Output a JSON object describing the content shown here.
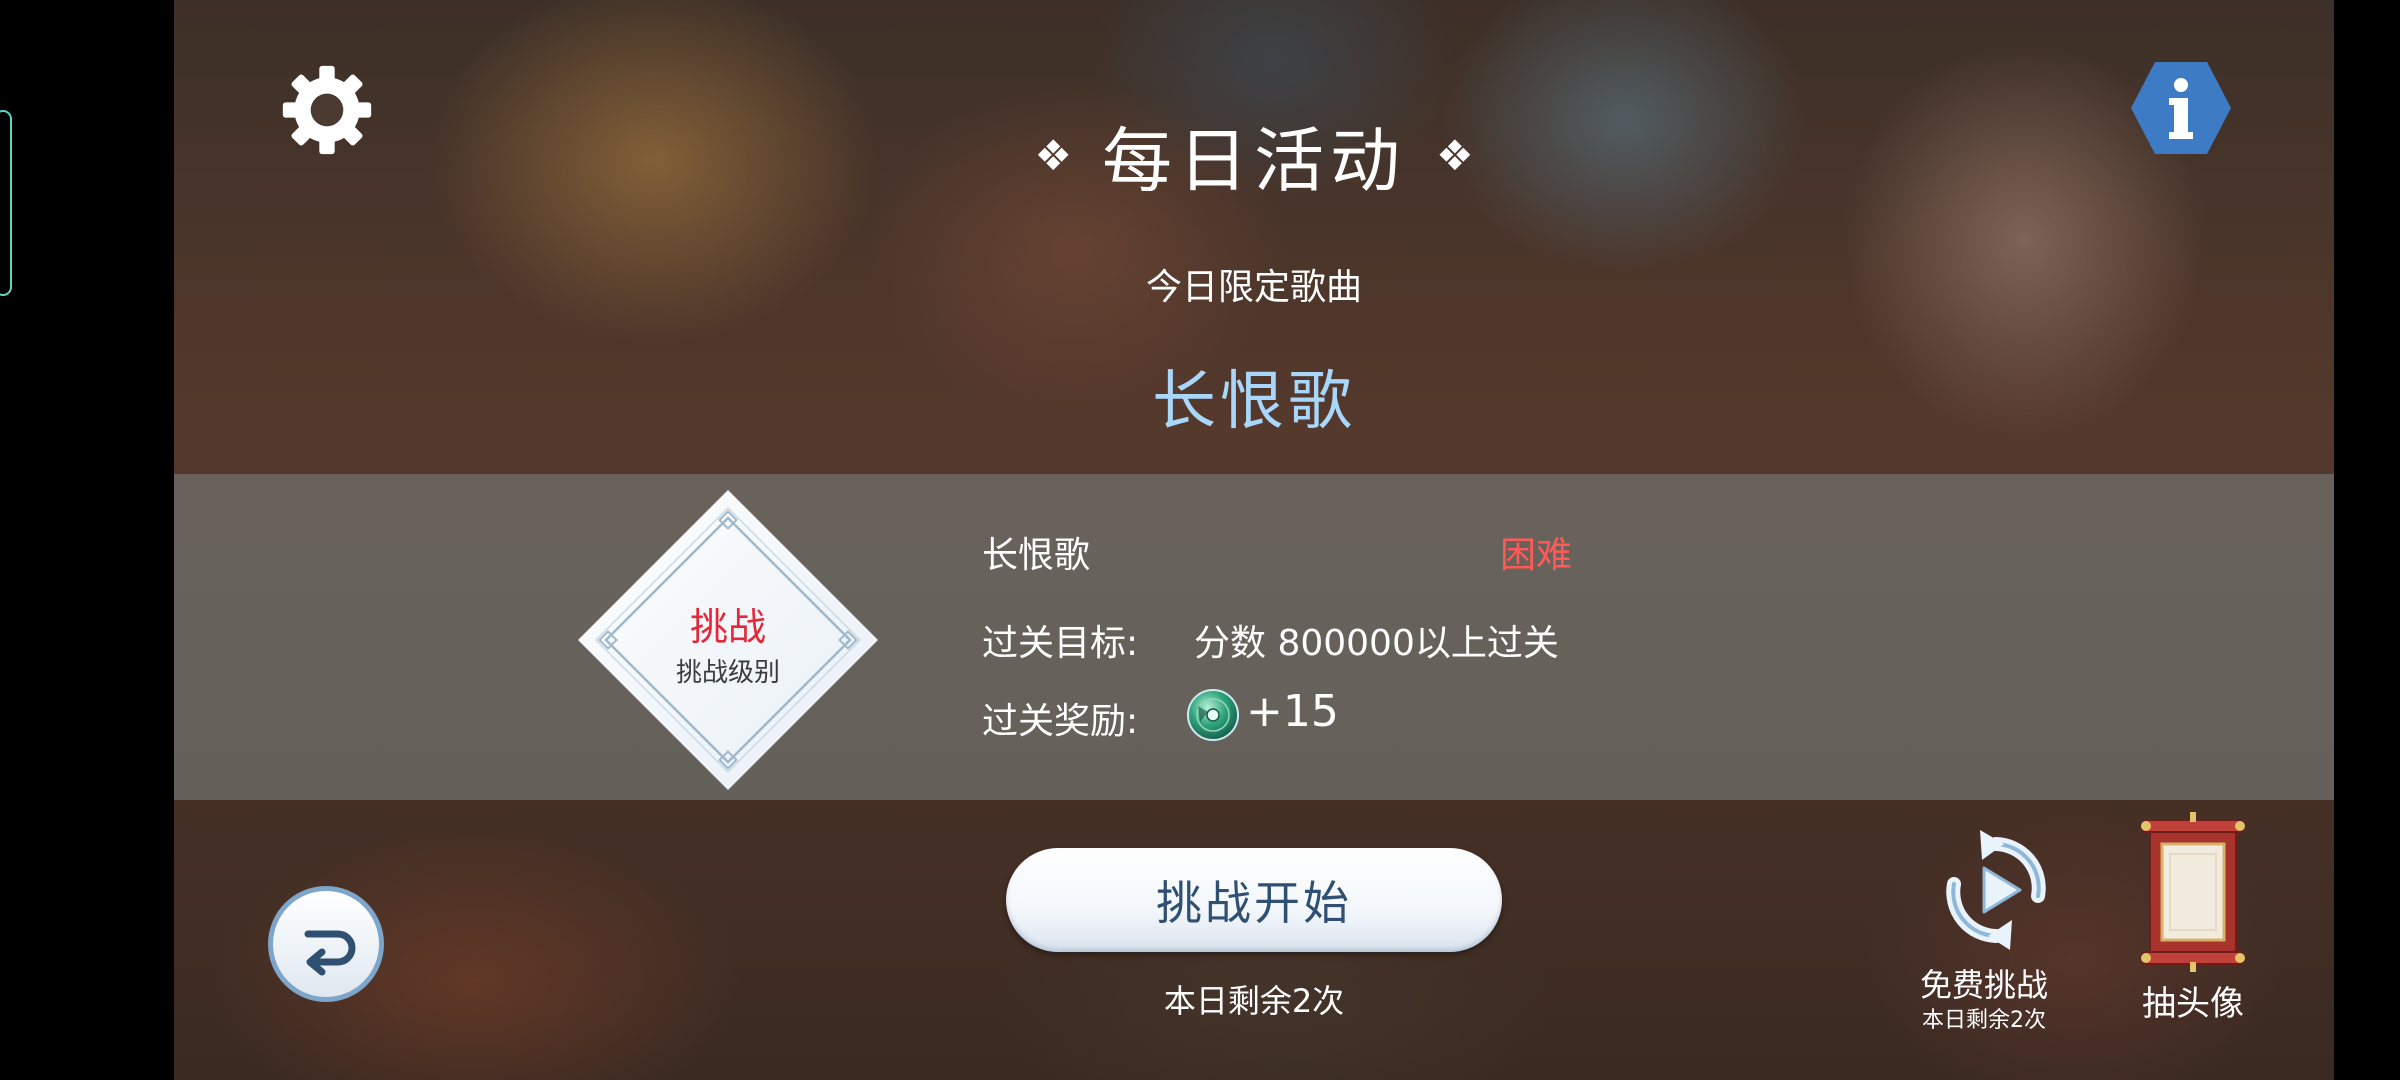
{
  "header": {
    "title": "每日活动",
    "title_deco_left": "❖",
    "title_deco_right": "❖",
    "subtitle": "今日限定歌曲",
    "song_title": "长恨歌"
  },
  "icons": {
    "settings": "gear-icon",
    "info": "info-icon",
    "back": "return-arrow-icon",
    "free_challenge": "replay-icon",
    "draw_avatar": "scroll-icon",
    "reward": "disc-icon"
  },
  "level": {
    "badge_main": "挑战",
    "badge_sub": "挑战级别",
    "song": "长恨歌",
    "difficulty": "困难",
    "goal_label": "过关目标:",
    "goal_value": "分数 800000以上过关",
    "reward_label": "过关奖励:",
    "reward_value": "+15"
  },
  "actions": {
    "start_label": "挑战开始",
    "remaining_today": "本日剩余2次",
    "free_label": "免费挑战",
    "free_remaining": "本日剩余2次",
    "avatar_label": "抽头像"
  },
  "colors": {
    "song_title": "#a9d7fb",
    "difficulty": "#ff5a57",
    "badge_main": "#e4283a",
    "start_text": "#2f4f73",
    "info_hex": "#3d7cc4"
  }
}
